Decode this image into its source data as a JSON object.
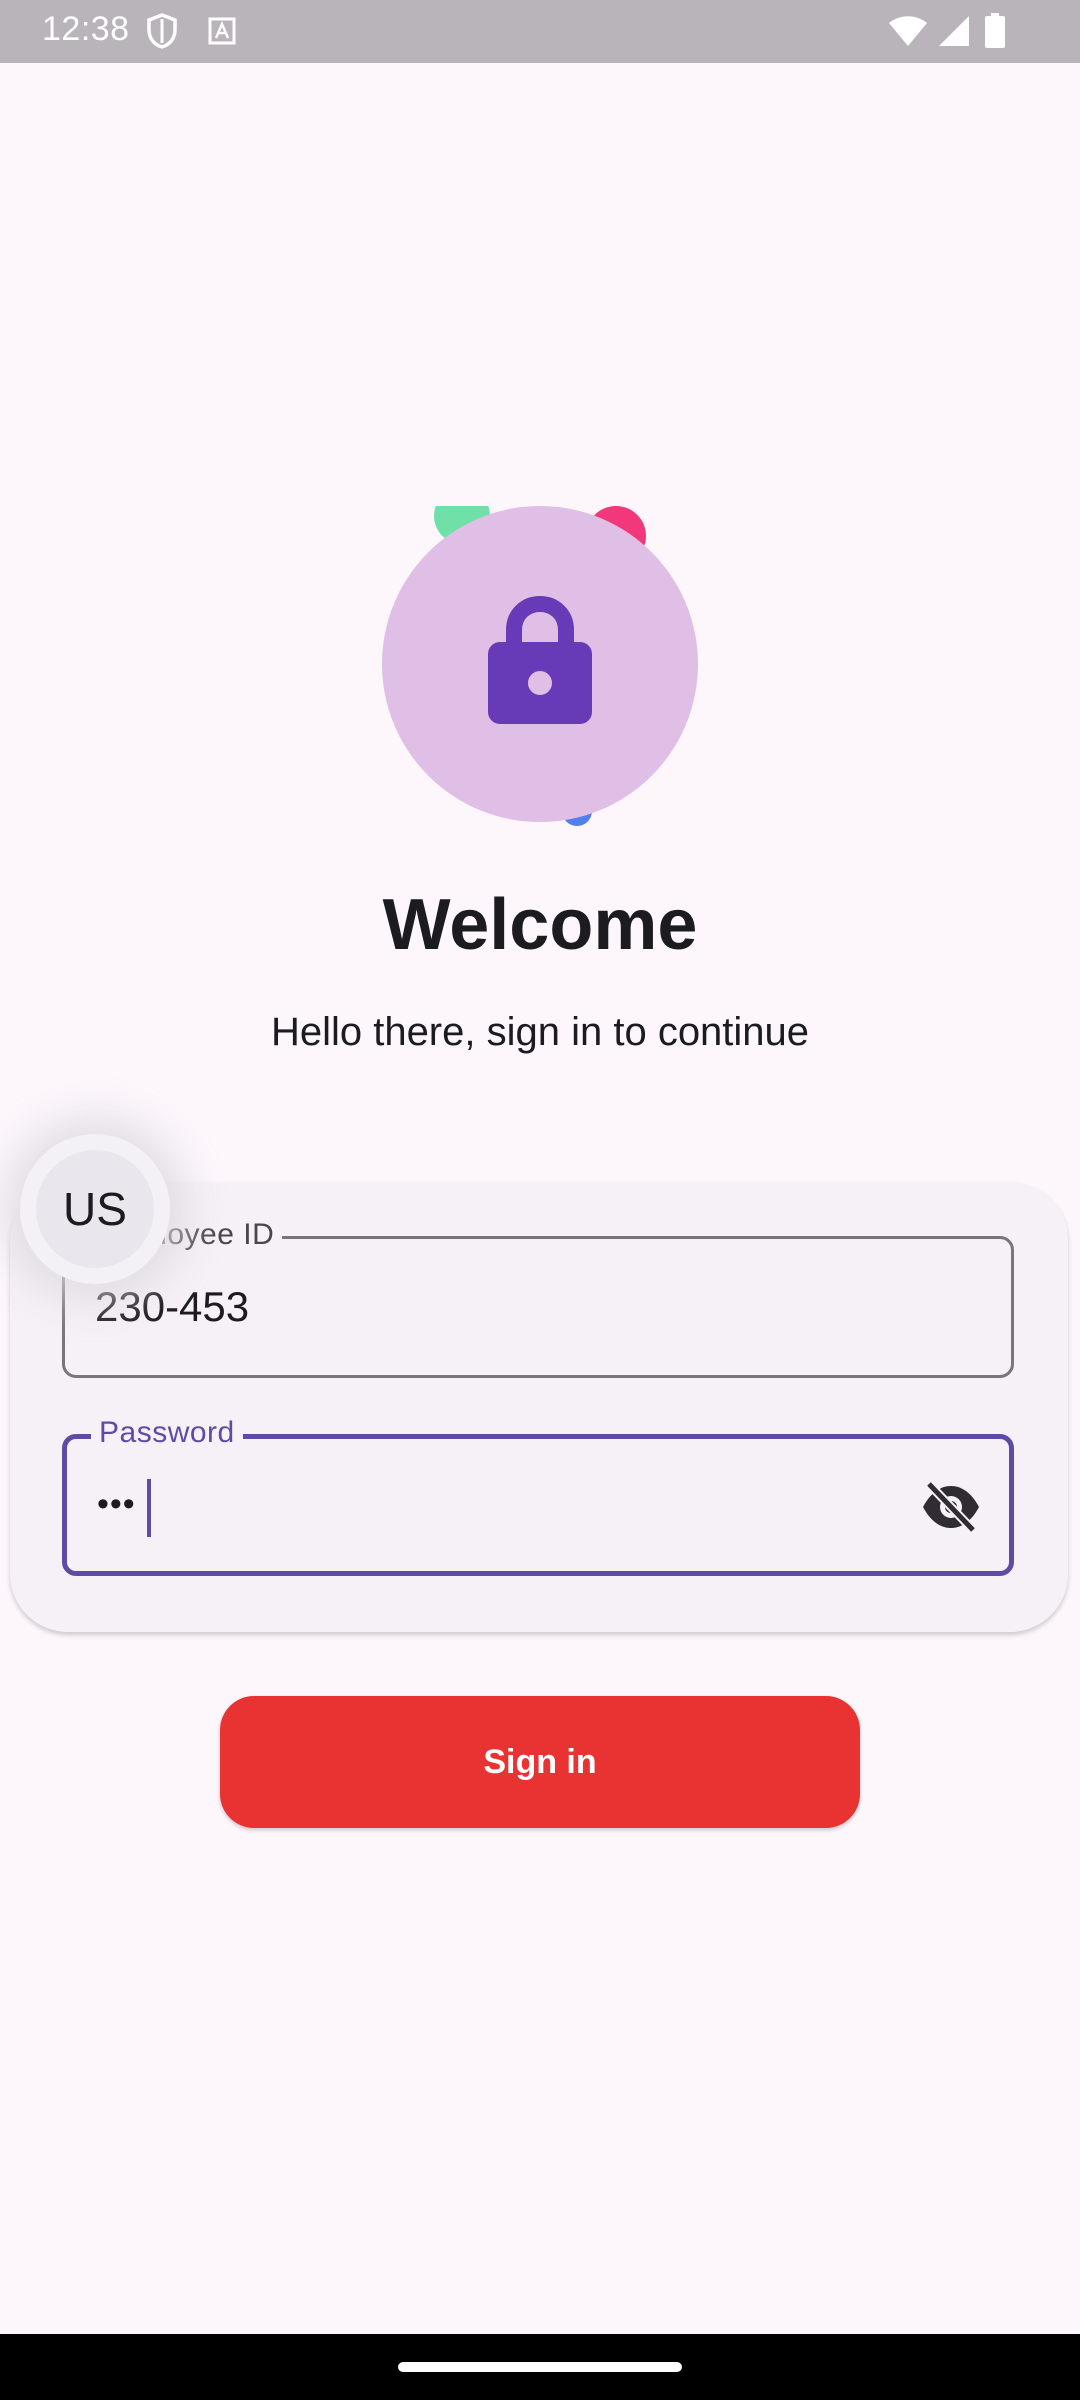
{
  "status_bar": {
    "time": "12:38",
    "icons": [
      "shield-icon",
      "text-a-icon",
      "wifi-icon",
      "signal-icon",
      "battery-icon"
    ]
  },
  "login": {
    "title": "Welcome",
    "subtitle": "Hello there, sign in to continue",
    "avatar_initials": "US",
    "employee_field": {
      "label": "Employee ID",
      "value": "230-453"
    },
    "password_field": {
      "label": "Password",
      "masked_value": "•••",
      "visibility_icon": "visibility-off-icon"
    },
    "sign_in_label": "Sign in"
  },
  "colors": {
    "background": "#fdf7fc",
    "accent": "#5f4ba3",
    "lock_circle": "#dfbfe6",
    "button": "#e93333"
  }
}
